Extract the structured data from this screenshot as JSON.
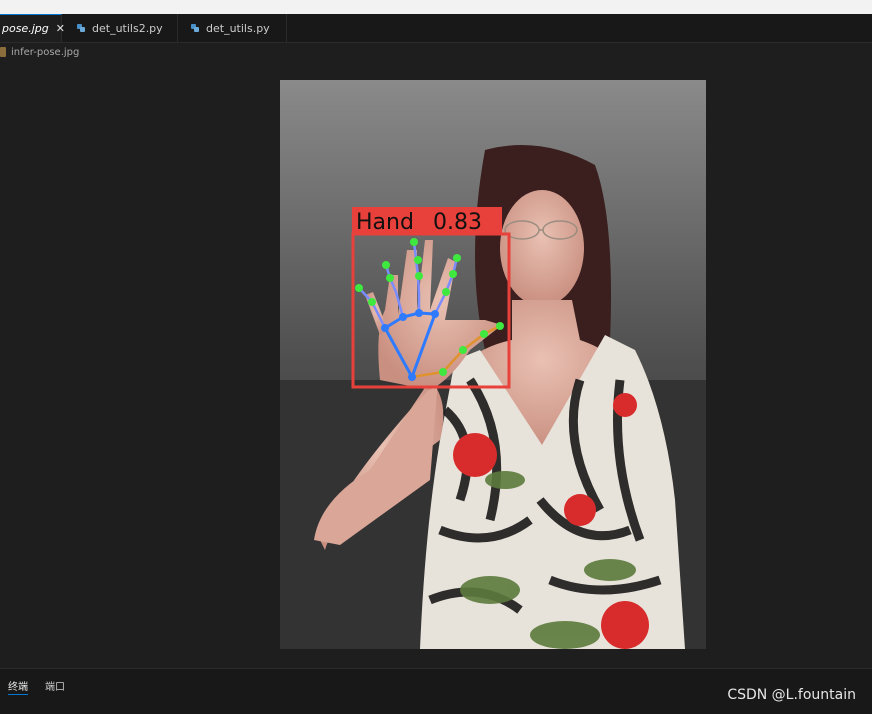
{
  "tabs": [
    {
      "label": "pose.jpg",
      "active": true
    },
    {
      "label": "det_utils2.py",
      "active": false
    },
    {
      "label": "det_utils.py",
      "active": false
    }
  ],
  "close_symbol": "✕",
  "breadcrumb": {
    "file": "infer-pose.jpg"
  },
  "detection": {
    "label": "Hand",
    "score": "0.83",
    "box_color": "#e8403a",
    "keypoint_color": "#3fe83f",
    "skeleton_color": "#2f7bff"
  },
  "panel": {
    "tabs": [
      "终端",
      "端口"
    ]
  },
  "watermark": "CSDN @L.fountain",
  "colors": {
    "accent": "#0078d4",
    "editor_bg": "#1e1e1e"
  }
}
